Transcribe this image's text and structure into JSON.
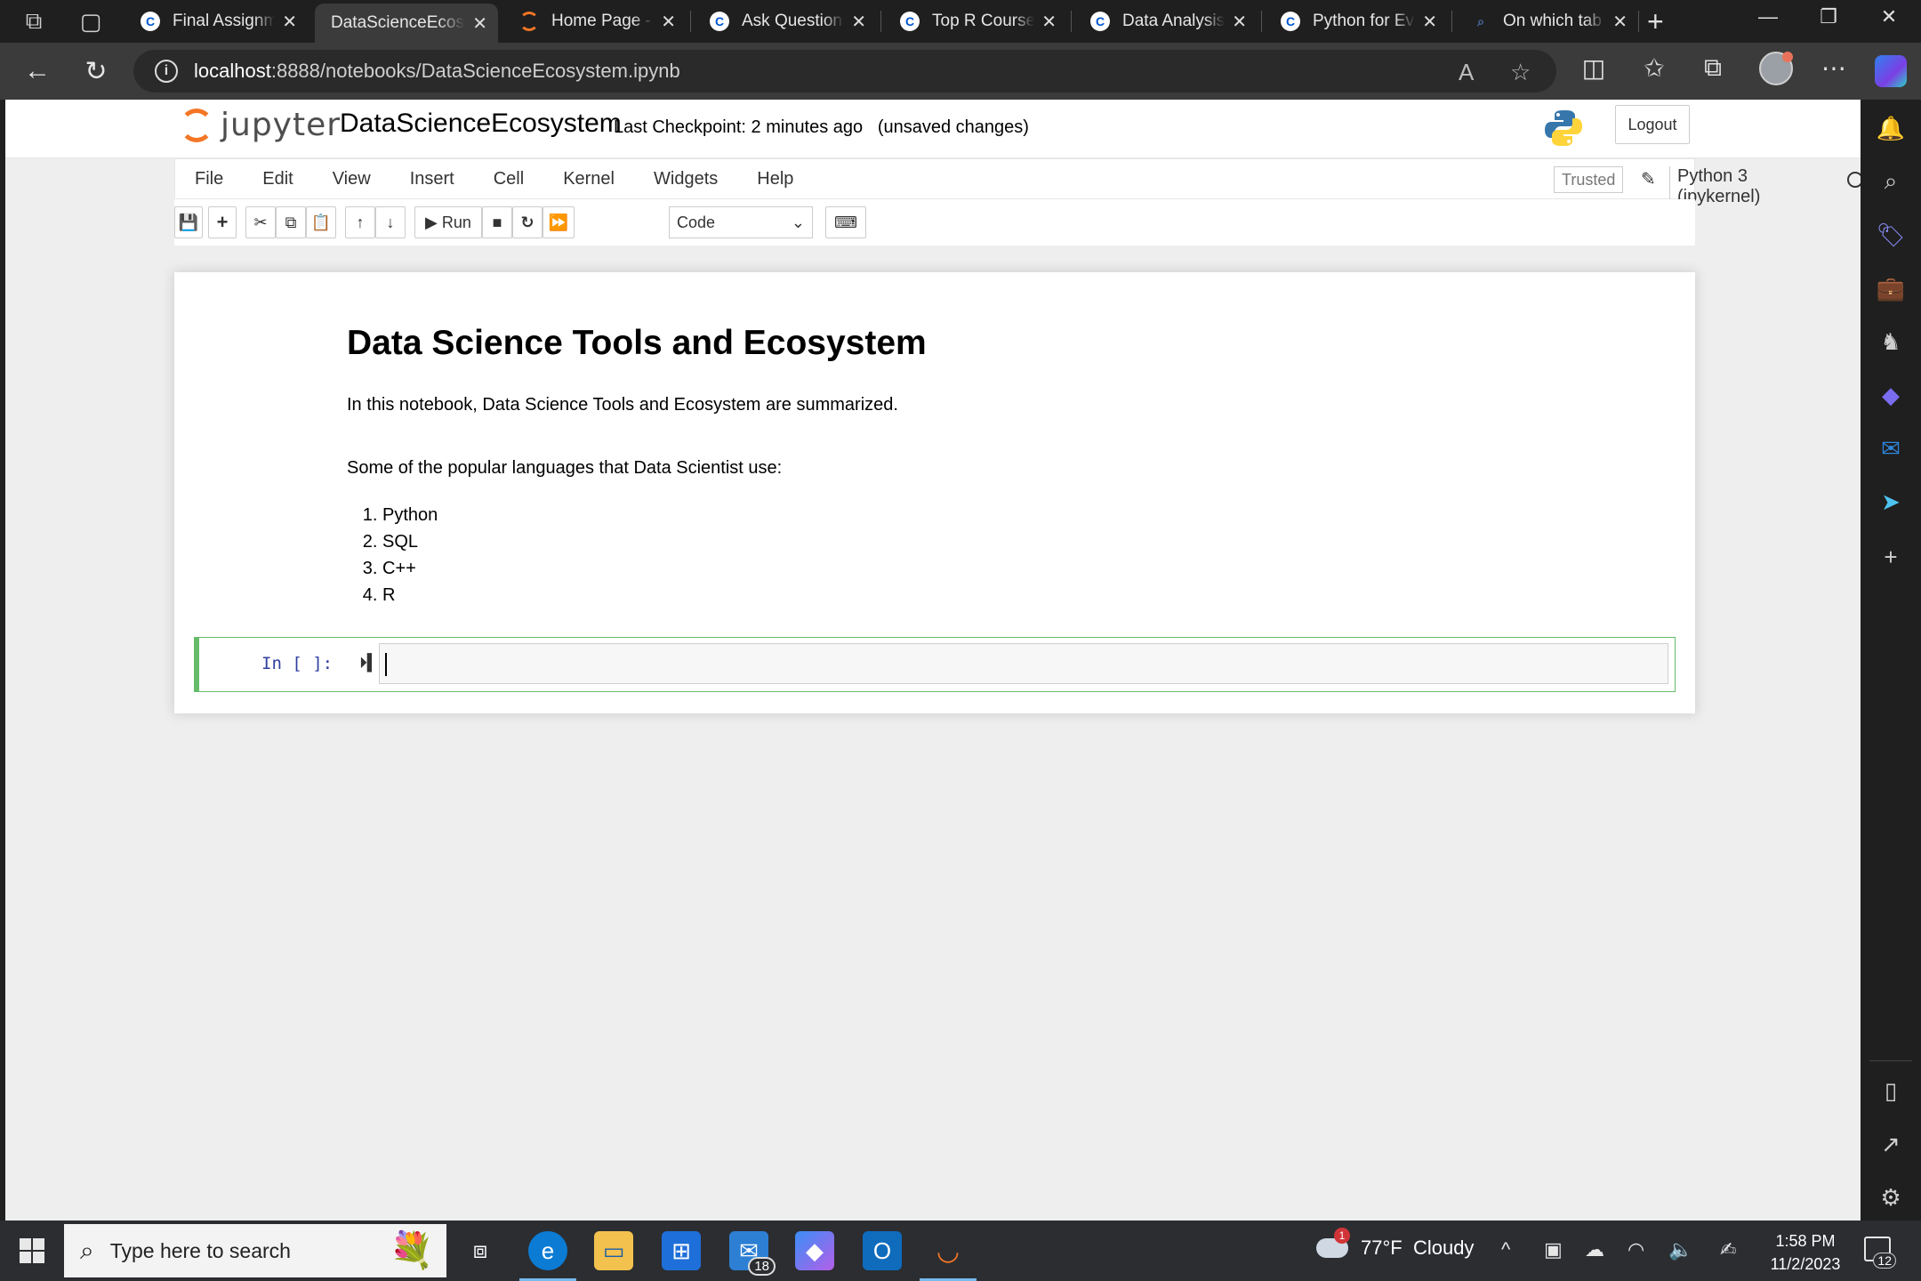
{
  "browser": {
    "tabs": [
      {
        "title": "Final Assignment",
        "favicon": "coursera-icon",
        "active": false
      },
      {
        "title": "DataScienceEcosystem",
        "favicon": "notebook-icon",
        "active": true
      },
      {
        "title": "Home Page - Select",
        "favicon": "jupyter-icon",
        "active": false
      },
      {
        "title": "Ask Questions",
        "favicon": "coursera-icon",
        "active": false
      },
      {
        "title": "Top R Courses",
        "favicon": "coursera-icon",
        "active": false
      },
      {
        "title": "Data Analysis with",
        "favicon": "coursera-icon",
        "active": false
      },
      {
        "title": "Python for Everybody",
        "favicon": "coursera-icon",
        "active": false
      },
      {
        "title": "On which tab is",
        "favicon": "search-icon",
        "active": false
      }
    ],
    "address": {
      "host": "localhost",
      "path": ":8888/notebooks/DataScienceEcosystem.ipynb"
    }
  },
  "jupyter": {
    "logo_text": "jupyter",
    "notebook_name": "DataScienceEcosystem",
    "checkpoint": "Last Checkpoint: 2 minutes ago",
    "unsaved": "(unsaved changes)",
    "logout_label": "Logout",
    "menu": [
      "File",
      "Edit",
      "View",
      "Insert",
      "Cell",
      "Kernel",
      "Widgets",
      "Help"
    ],
    "trusted_label": "Trusted",
    "kernel_name": "Python 3 (ipykernel)",
    "toolbar": {
      "run_label": "Run",
      "cell_type": "Code"
    }
  },
  "notebook": {
    "heading": "Data Science Tools and Ecosystem",
    "intro": "In this notebook, Data Science Tools and Ecosystem are summarized.",
    "languages_intro": "Some of the popular languages that Data Scientist use:",
    "languages": [
      "Python",
      "SQL",
      "C++",
      "R"
    ],
    "code_prompt": "In [ ]:"
  },
  "taskbar": {
    "search_placeholder": "Type here to search",
    "mail_badge": "18",
    "weather_alert": "1",
    "temperature": "77°F",
    "condition": "Cloudy",
    "time": "1:58 PM",
    "date": "11/2/2023",
    "notification_count": "12"
  },
  "colors": {
    "jupyter_orange": "#f37626",
    "cell_selected_green": "#66bb6a",
    "prompt_blue": "#303f9f",
    "edge_dark": "#1f1f1f",
    "edge_toolbar": "#3b3b3b",
    "taskbar": "#2b2d31"
  }
}
